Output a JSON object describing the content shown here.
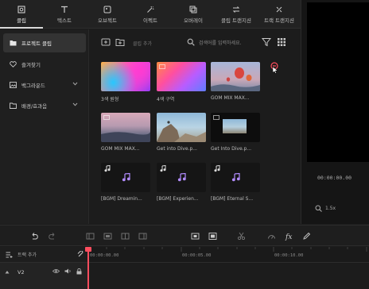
{
  "tabs": [
    {
      "label": "클립",
      "icon": "clip-icon"
    },
    {
      "label": "텍스트",
      "icon": "text-icon"
    },
    {
      "label": "오브젝트",
      "icon": "object-icon"
    },
    {
      "label": "이펙트",
      "icon": "effect-icon"
    },
    {
      "label": "오버레이",
      "icon": "overlay-icon"
    },
    {
      "label": "클립 트랜지션",
      "icon": "clip-transition-icon"
    },
    {
      "label": "트랙 트랜지션",
      "icon": "track-transition-icon"
    }
  ],
  "sidebar": {
    "items": [
      {
        "label": "프로젝트 클립",
        "icon": "folder-icon"
      },
      {
        "label": "즐겨찾기",
        "icon": "heart-icon"
      },
      {
        "label": "백그라운드",
        "icon": "background-icon"
      },
      {
        "label": "배경/효과음",
        "icon": "music-folder-icon"
      }
    ]
  },
  "media": {
    "filter_label": "클립 추가",
    "search_placeholder": "검색어를 입력하세요."
  },
  "clips": [
    {
      "caption": "3색 원형",
      "kind": "grad1"
    },
    {
      "caption": "4색 구역",
      "kind": "grad2"
    },
    {
      "caption": "GOM MIX MAX...",
      "kind": "balloon"
    },
    {
      "caption": "GOM MIX MAX...",
      "kind": "sunset"
    },
    {
      "caption": "Get into Dive.p...",
      "kind": "rock"
    },
    {
      "caption": "Get Into Dive.p...",
      "kind": "dark"
    },
    {
      "caption": "[BGM] Dreamin...",
      "kind": "audio"
    },
    {
      "caption": "[BGM] Experien...",
      "kind": "audio"
    },
    {
      "caption": "[BGM] Eternal S...",
      "kind": "audio"
    }
  ],
  "preview": {
    "timecode": "00:00:00.00",
    "zoom": "1.5x"
  },
  "timeline": {
    "add_track_label": "트랙 추가",
    "ticks": [
      "00:00:00.00",
      "00:00:05.00",
      "00:00:10.00"
    ],
    "track_name": "V2"
  },
  "colors": {
    "accent": "#ff4d5e",
    "audio": "#b28cff"
  }
}
